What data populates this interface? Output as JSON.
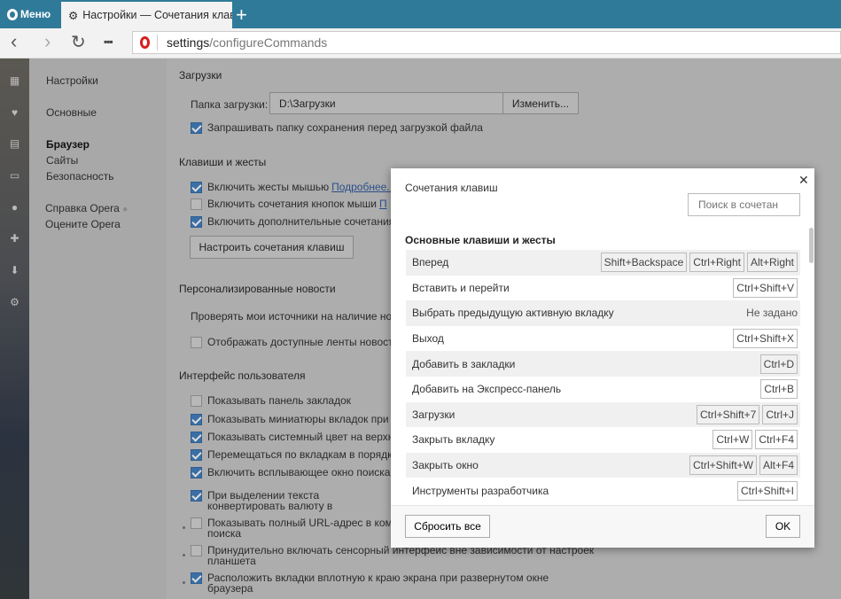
{
  "browser": {
    "menu_label": "Меню",
    "tab_title": "Настройки — Сочетания клавиш",
    "address_host": "settings",
    "address_path": "/configureCommands"
  },
  "leftnav": {
    "title": "Настройки",
    "items": [
      "Основные",
      "Браузер",
      "Сайты",
      "Безопасность",
      "Справка Opera",
      "Оцените Opera"
    ],
    "active": "Браузер"
  },
  "downloads": {
    "heading": "Загрузки",
    "folder_label": "Папка загрузки:",
    "folder_value": "D:\\Загрузки",
    "change_button": "Изменить...",
    "ask_label": "Запрашивать папку сохранения перед загрузкой файла"
  },
  "keys_section": {
    "heading": "Клавиши и жесты",
    "gestures": "Включить жесты мышью",
    "gestures_link": "Подробнее...",
    "rocker": "Включить сочетания кнопок мыши",
    "rocker_link": "П",
    "advanced": "Включить дополнительные сочетания",
    "configure_button": "Настроить сочетания клавиш"
  },
  "news": {
    "heading": "Персонализированные новости",
    "check": "Проверять мои источники на наличие но",
    "show": "Отображать доступные ленты новост"
  },
  "ui": {
    "heading": "Интерфейс пользователя",
    "items": [
      "Показывать панель закладок",
      "Показывать миниатюры вкладок при",
      "Показывать системный цвет на верхн",
      "Перемещаться по вкладкам в порядк",
      "Включить всплывающее окно поиска",
      "При выделении текста|конвертировать валюту в",
      "Показывать полный URL-адрес в ком|поиска",
      "Принудительно включать сенсорный интерфейс вне зависимости от настроек|планшета",
      "Расположить вкладки вплотную к краю экрана при развернутом окне|браузера"
    ]
  },
  "dialog": {
    "title": "Сочетания клавиш",
    "search_placeholder": "Поиск в сочетан",
    "section": "Основные клавиши и жесты",
    "reset_button": "Сбросить все",
    "ok_button": "OK",
    "rows": [
      {
        "name": "Вперед",
        "keys": [
          "Shift+Backspace",
          "Ctrl+Right",
          "Alt+Right"
        ]
      },
      {
        "name": "Вставить и перейти",
        "keys": [
          "Ctrl+Shift+V"
        ]
      },
      {
        "name": "Выбрать предыдущую активную вкладку",
        "unset": "Не задано"
      },
      {
        "name": "Выход",
        "keys": [
          "Ctrl+Shift+X"
        ]
      },
      {
        "name": "Добавить в закладки",
        "keys": [
          "Ctrl+D"
        ]
      },
      {
        "name": "Добавить на Экспресс-панель",
        "keys": [
          "Ctrl+B"
        ]
      },
      {
        "name": "Загрузки",
        "keys": [
          "Ctrl+Shift+7",
          "Ctrl+J"
        ]
      },
      {
        "name": "Закрыть вкладку",
        "keys": [
          "Ctrl+W",
          "Ctrl+F4"
        ]
      },
      {
        "name": "Закрыть окно",
        "keys": [
          "Ctrl+Shift+W",
          "Alt+F4"
        ]
      },
      {
        "name": "Инструменты разработчика",
        "keys": [
          "Ctrl+Shift+I"
        ]
      }
    ]
  }
}
